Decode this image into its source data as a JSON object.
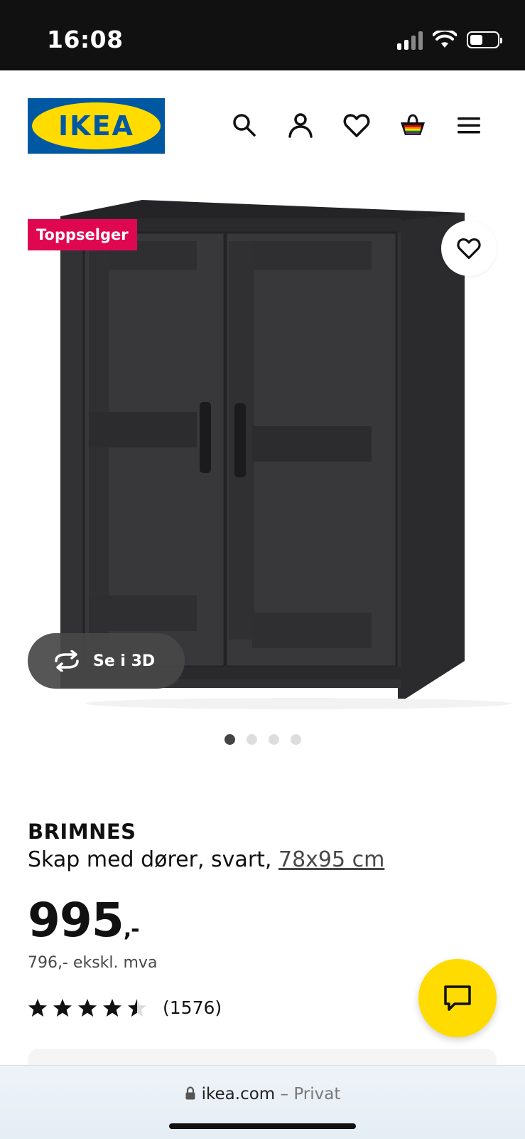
{
  "status_bar": {
    "time": "16:08"
  },
  "header": {
    "logo_text": "IKEA",
    "icons": [
      "search-icon",
      "account-icon",
      "heart-icon",
      "basket-icon",
      "menu-icon"
    ]
  },
  "hero": {
    "badge": "Toppselger",
    "view_3d_label": "Se i 3D",
    "carousel": {
      "total": 4,
      "active": 1
    }
  },
  "product": {
    "name": "BRIMNES",
    "description": "Skap med dører, svart, ",
    "size_link": "78x95 cm",
    "price_main": "995",
    "price_suffix": ",-",
    "price_ex_vat": "796,- ekskl. mva",
    "rating": {
      "stars": 4.5,
      "max": 5,
      "count_label": "(1576)"
    }
  },
  "browser": {
    "domain": "ikea.com",
    "mode": "– Privat"
  },
  "colors": {
    "ikea_blue": "#0058a3",
    "ikea_yellow": "#ffdb00",
    "badge_red": "#e00751"
  }
}
